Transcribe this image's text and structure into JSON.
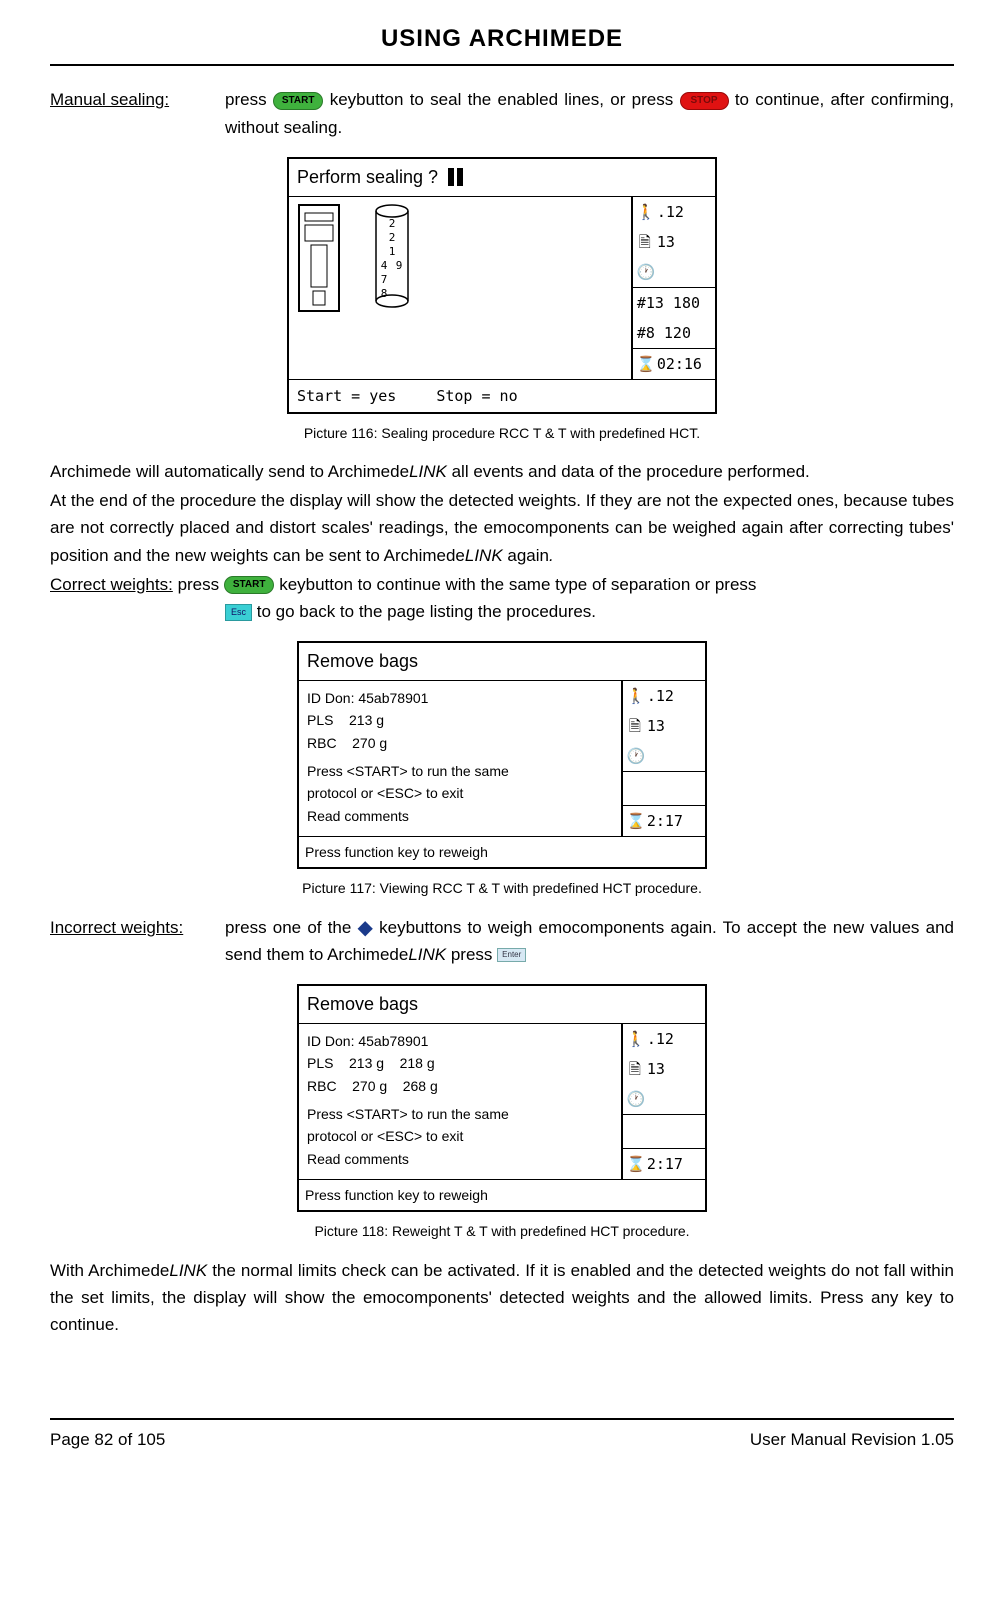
{
  "header": {
    "title": "USING ARCHIMEDE"
  },
  "labels": {
    "manual_sealing": "Manual sealing:",
    "correct_weights": "Correct weights:",
    "incorrect_weights": "Incorrect weights:"
  },
  "buttons": {
    "start": "START",
    "stop": "STOP",
    "esc": "Esc",
    "enter": "Enter",
    "arrow": "◆"
  },
  "text": {
    "manual_a": "press ",
    "manual_b": " keybutton to seal the enabled lines, or press ",
    "manual_c": " to continue, after confirming, without sealing.",
    "para1a": "Archimede will automatically send to Archimede",
    "link": "LINK",
    "para1b": " all events and data of the procedure performed.",
    "para2a": "At the end of the procedure the display will show the detected weights. If they are not the expected ones, because tubes are not correctly placed and distort scales' readings, the emocomponents can be weighed again after correcting tubes' position and the new weights can be sent to Archimede",
    "para2b": " again",
    "para2c": ".",
    "correct_a": "  press ",
    "correct_b": " keybutton to continue with the same type of separation or press ",
    "correct_c": " to go back to the page listing the procedures.",
    "incorrect_a": "press one of the ",
    "incorrect_b": " keybuttons to weigh emocomponents again. To accept the new values and send them to Archimede",
    "incorrect_c": " press ",
    "final_a": "With Archimede",
    "final_b": " the normal limits check can be activated. If it is enabled and the detected weights do not fall within the set limits, the display will show the emocomponents' detected weights and the allowed limits. Press any key to continue."
  },
  "captions": {
    "p116": "Picture 116: Sealing procedure  RCC T & T with predefined HCT.",
    "p117": "Picture 117: Viewing RCC T & T  with predefined HCT procedure.",
    "p118": "Picture 118: Reweight T & T with predefined HCT procedure."
  },
  "screen1": {
    "title": "Perform sealing ?",
    "digits": [
      "2",
      "2",
      "1",
      "4",
      "9",
      "7",
      "8"
    ],
    "bottom_yes": "Start = yes",
    "bottom_no": "Stop = no",
    "side": {
      "r1": ".12",
      "r2": "13",
      "r3": "",
      "r4": "#13 180",
      "r5": "#8 120",
      "r6": "02:16"
    }
  },
  "screen2": {
    "title": "Remove bags",
    "id": "ID Don: 45ab78901",
    "pls": "PLS    213 g",
    "rbc": "RBC    270 g",
    "line1": "Press <START> to run the same",
    "line2": "protocol  or  <ESC> to exit",
    "line3": "Read comments",
    "footer": "Press function key to reweigh",
    "side": {
      "r1": ".12",
      "r2": "13",
      "r3": "",
      "r6": "2:17"
    }
  },
  "screen3": {
    "title": "Remove bags",
    "id": "ID Don: 45ab78901",
    "pls": "PLS    213 g    218 g",
    "rbc": "RBC    270 g    268 g",
    "line1": "Press <START> to run the same",
    "line2": "protocol  or  <ESC> to exit",
    "line3": "Read comments",
    "footer": "Press function key to reweigh",
    "side": {
      "r1": ".12",
      "r2": "13",
      "r3": "",
      "r6": "2:17"
    }
  },
  "footer": {
    "page": "Page 82 of 105",
    "rev": "User Manual Revision 1.05"
  }
}
